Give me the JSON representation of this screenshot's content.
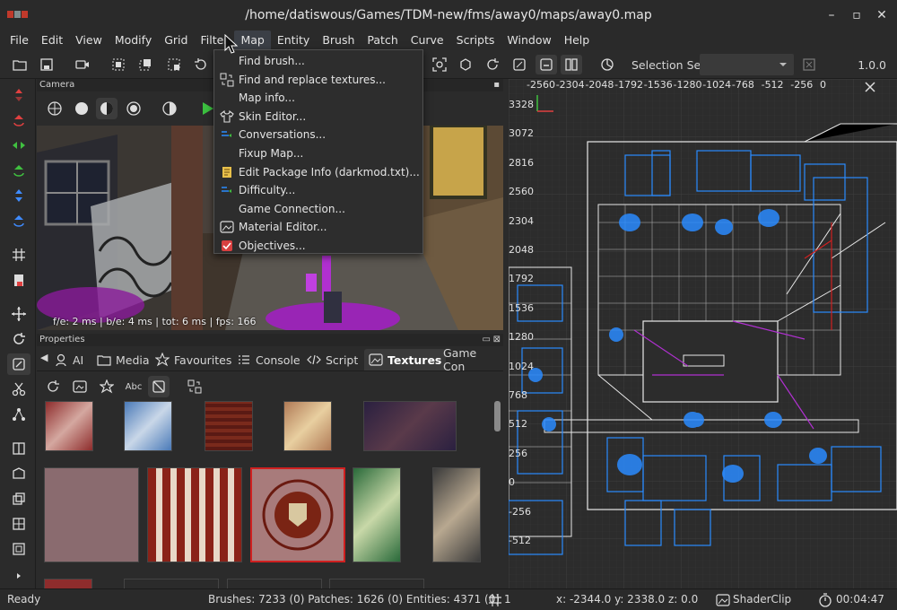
{
  "window": {
    "title": "/home/datiswous/Games/TDM-new/fms/away0/maps/away0.map"
  },
  "menubar": {
    "items": [
      "File",
      "Edit",
      "View",
      "Modify",
      "Grid",
      "Filter",
      "Map",
      "Entity",
      "Brush",
      "Patch",
      "Curve",
      "Scripts",
      "Window",
      "Help"
    ],
    "active_index": 6
  },
  "toolbar": {
    "selection_set_label": "Selection Set:",
    "selection_set_value": "",
    "version": "1.0.0"
  },
  "map_menu": {
    "items": [
      {
        "label": "Find brush...",
        "icon": "none"
      },
      {
        "label": "Find and replace textures...",
        "icon": "find-replace-icon"
      },
      {
        "label": "Map info...",
        "icon": "none"
      },
      {
        "label": "Skin Editor...",
        "icon": "shirt-icon"
      },
      {
        "label": "Conversations...",
        "icon": "conversation-icon"
      },
      {
        "label": "Fixup Map...",
        "icon": "none"
      },
      {
        "label": "Edit Package Info (darkmod.txt)...",
        "icon": "package-icon"
      },
      {
        "label": "Difficulty...",
        "icon": "difficulty-icon"
      },
      {
        "label": "Game Connection...",
        "icon": "none"
      },
      {
        "label": "Material Editor...",
        "icon": "image-icon"
      },
      {
        "label": "Objectives...",
        "icon": "checkbox-icon"
      }
    ]
  },
  "camera": {
    "panel_title": "Camera",
    "stats": "f/e: 2 ms | b/e: 4 ms | tot: 6 ms | fps: 166"
  },
  "properties": {
    "panel_title": "Properties",
    "tabs": [
      {
        "label": "AI",
        "icon": "ai-icon"
      },
      {
        "label": "Media",
        "icon": "folder-icon"
      },
      {
        "label": "Favourites",
        "icon": "star-icon"
      },
      {
        "label": "Console",
        "icon": "console-icon"
      },
      {
        "label": "Script",
        "icon": "code-icon"
      },
      {
        "label": "Textures",
        "icon": "image-icon"
      },
      {
        "label": "Game Con",
        "icon": "none"
      }
    ],
    "active_tab": "Textures",
    "tex_tool_labels": {
      "abc": "Abc"
    }
  },
  "ortho": {
    "top_ruler": [
      "-2560",
      "-2304",
      "-2048",
      "-1792",
      "-1536",
      "-1280",
      "-1024",
      "-768",
      "-512",
      "-256",
      "0"
    ],
    "left_ruler": [
      "3328",
      "3072",
      "2816",
      "2560",
      "2304",
      "2048",
      "1792",
      "1536",
      "1280",
      "1024",
      "768",
      "512",
      "256",
      "0",
      "-256",
      "-512"
    ]
  },
  "status": {
    "ready": "Ready",
    "counts": "Brushes: 7233 (0) Patches: 1626 (0) Entities: 4371 (0)",
    "grid": "1",
    "coords": "x: -2344.0 y: 2338.0 z:  0.0",
    "shader": "ShaderClip",
    "time": "00:04:47"
  },
  "colors": {
    "accent_blue": "#2a8bff",
    "brush_white": "#e8e8e8",
    "selection_red": "#d02020",
    "entity_magenta": "#b030d0"
  }
}
